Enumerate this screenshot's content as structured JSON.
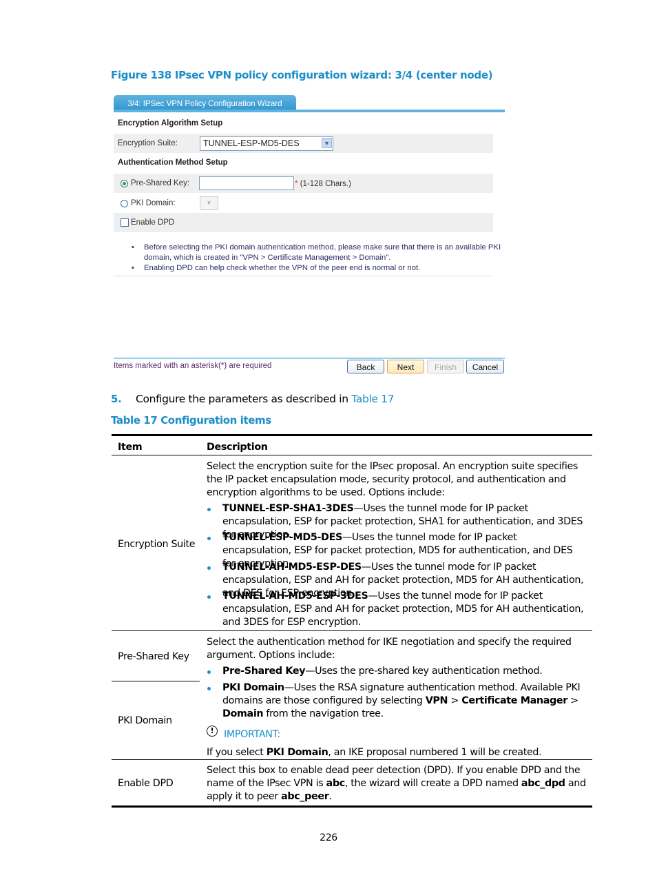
{
  "figure_title": "Figure 138 IPsec VPN policy configuration wizard: 3/4 (center node)",
  "wizard": {
    "tab_label": "3/4: IPSec VPN Policy Configuration Wizard",
    "encryption_section": "Encryption Algorithm Setup",
    "encryption_suite_label": "Encryption Suite:",
    "encryption_suite_value": "TUNNEL-ESP-MD5-DES",
    "auth_section": "Authentication Method Setup",
    "psk_label": "Pre-Shared Key:",
    "psk_value": "",
    "psk_required_mark": "*",
    "psk_hint": "(1-128 Chars.)",
    "psk_selected": true,
    "pki_label": "PKI Domain:",
    "pki_selected": false,
    "dpd_label": "Enable DPD",
    "dpd_checked": false,
    "notes": [
      "Before selecting the PKI domain authentication method, please make sure that there is an available PKI domain, which is created in \"VPN > Certificate Management > Domain\".",
      "Enabling DPD can help check whether the VPN of the peer end is normal or not."
    ],
    "footer_text": "Items marked with an asterisk(*) are required",
    "buttons": {
      "back": "Back",
      "next": "Next",
      "finish": "Finish",
      "cancel": "Cancel"
    }
  },
  "step": {
    "number": "5.",
    "text": "Configure the parameters as described in ",
    "link": "Table 17"
  },
  "table_title": "Table 17 Configuration items",
  "table": {
    "headers": [
      "Item",
      "Description"
    ],
    "rows": {
      "encryption_suite": {
        "item": "Encryption Suite",
        "intro": "Select the encryption suite for the IPsec proposal. An encryption suite specifies the IP packet encapsulation mode, security protocol, and authentication and encryption algorithms to be used. Options include:",
        "options": [
          {
            "name": "TUNNEL-ESP-SHA1-3DES",
            "text": "—Uses the tunnel mode for IP packet encapsulation, ESP for packet protection, SHA1 for authentication, and 3DES for encryption."
          },
          {
            "name": "TUNNEL-ESP-MD5-DES",
            "text": "—Uses the tunnel mode for IP packet encapsulation, ESP for packet protection, MD5 for authentication, and DES for encryption."
          },
          {
            "name": "TUNNEL-AH-MD5-ESP-DES",
            "text": "—Uses the tunnel mode for IP packet encapsulation, ESP and AH for packet protection, MD5 for AH authentication, and DES for ESP encryption."
          },
          {
            "name": "TUNNEL-AH-MD5-ESP-3DES",
            "text": "—Uses the tunnel mode for IP packet encapsulation, ESP and AH for packet protection, MD5 for AH authentication, and 3DES for ESP encryption."
          }
        ]
      },
      "pre_shared_key": {
        "item": "Pre-Shared Key",
        "intro": "Select the authentication method for IKE negotiation and specify the required argument. Options include:",
        "option_name": "Pre-Shared Key",
        "option_text": "—Uses the pre-shared key authentication method."
      },
      "pki_domain": {
        "item": "PKI Domain",
        "option_name": "PKI Domain",
        "option_text_1": "—Uses the RSA signature authentication method. Available PKI domains are those configured by selecting ",
        "path_1": "VPN",
        "sep": " > ",
        "path_2": "Certificate Manager",
        "path_3": "Domain",
        "option_text_2": " from the navigation tree.",
        "important_label": "IMPORTANT:",
        "important_pre": "If you select ",
        "important_bold": "PKI Domain",
        "important_post": ", an IKE proposal numbered 1 will be created."
      },
      "enable_dpd": {
        "item": "Enable DPD",
        "t1": "Select this box to enable dead peer detection (DPD). If you enable DPD and the name of the IPsec VPN is ",
        "b1": "abc",
        "t2": ", the wizard will create a DPD named ",
        "b2": "abc_dpd",
        "t3": " and apply it to peer ",
        "b3": "abc_peer",
        "t4": "."
      }
    }
  },
  "page_number": "226"
}
